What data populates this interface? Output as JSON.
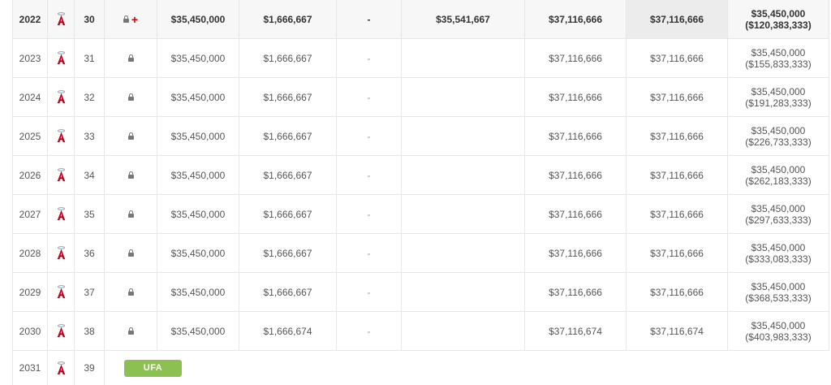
{
  "accent_colors": {
    "ufa_badge": "#8cc152",
    "injury_plus": "#d40000",
    "team_logo": "#ba0021"
  },
  "rows": [
    {
      "year": "2022",
      "age": "30",
      "status_icons": [
        "lock-icon",
        "injured-list-icon"
      ],
      "base": "$35,450,000",
      "bonus": "$1,666,667",
      "incentives": "-",
      "luxury_tax": "$35,541,667",
      "payroll": "$37,116,666",
      "adjusted": "$37,116,666",
      "remaining_top": "$35,450,000",
      "remaining_bottom": "($120,383,333)",
      "current": true
    },
    {
      "year": "2023",
      "age": "31",
      "status_icons": [
        "lock-icon"
      ],
      "base": "$35,450,000",
      "bonus": "$1,666,667",
      "incentives": "-",
      "luxury_tax": "",
      "payroll": "$37,116,666",
      "adjusted": "$37,116,666",
      "remaining_top": "$35,450,000",
      "remaining_bottom": "($155,833,333)"
    },
    {
      "year": "2024",
      "age": "32",
      "status_icons": [
        "lock-icon"
      ],
      "base": "$35,450,000",
      "bonus": "$1,666,667",
      "incentives": "-",
      "luxury_tax": "",
      "payroll": "$37,116,666",
      "adjusted": "$37,116,666",
      "remaining_top": "$35,450,000",
      "remaining_bottom": "($191,283,333)"
    },
    {
      "year": "2025",
      "age": "33",
      "status_icons": [
        "lock-icon"
      ],
      "base": "$35,450,000",
      "bonus": "$1,666,667",
      "incentives": "-",
      "luxury_tax": "",
      "payroll": "$37,116,666",
      "adjusted": "$37,116,666",
      "remaining_top": "$35,450,000",
      "remaining_bottom": "($226,733,333)"
    },
    {
      "year": "2026",
      "age": "34",
      "status_icons": [
        "lock-icon"
      ],
      "base": "$35,450,000",
      "bonus": "$1,666,667",
      "incentives": "-",
      "luxury_tax": "",
      "payroll": "$37,116,666",
      "adjusted": "$37,116,666",
      "remaining_top": "$35,450,000",
      "remaining_bottom": "($262,183,333)"
    },
    {
      "year": "2027",
      "age": "35",
      "status_icons": [
        "lock-icon"
      ],
      "base": "$35,450,000",
      "bonus": "$1,666,667",
      "incentives": "-",
      "luxury_tax": "",
      "payroll": "$37,116,666",
      "adjusted": "$37,116,666",
      "remaining_top": "$35,450,000",
      "remaining_bottom": "($297,633,333)"
    },
    {
      "year": "2028",
      "age": "36",
      "status_icons": [
        "lock-icon"
      ],
      "base": "$35,450,000",
      "bonus": "$1,666,667",
      "incentives": "-",
      "luxury_tax": "",
      "payroll": "$37,116,666",
      "adjusted": "$37,116,666",
      "remaining_top": "$35,450,000",
      "remaining_bottom": "($333,083,333)"
    },
    {
      "year": "2029",
      "age": "37",
      "status_icons": [
        "lock-icon"
      ],
      "base": "$35,450,000",
      "bonus": "$1,666,667",
      "incentives": "-",
      "luxury_tax": "",
      "payroll": "$37,116,666",
      "adjusted": "$37,116,666",
      "remaining_top": "$35,450,000",
      "remaining_bottom": "($368,533,333)"
    },
    {
      "year": "2030",
      "age": "38",
      "status_icons": [
        "lock-icon"
      ],
      "base": "$35,450,000",
      "bonus": "$1,666,674",
      "incentives": "-",
      "luxury_tax": "",
      "payroll": "$37,116,674",
      "adjusted": "$37,116,674",
      "remaining_top": "$35,450,000",
      "remaining_bottom": "($403,983,333)"
    }
  ],
  "final_row": {
    "year": "2031",
    "age": "39",
    "badge": "UFA"
  }
}
